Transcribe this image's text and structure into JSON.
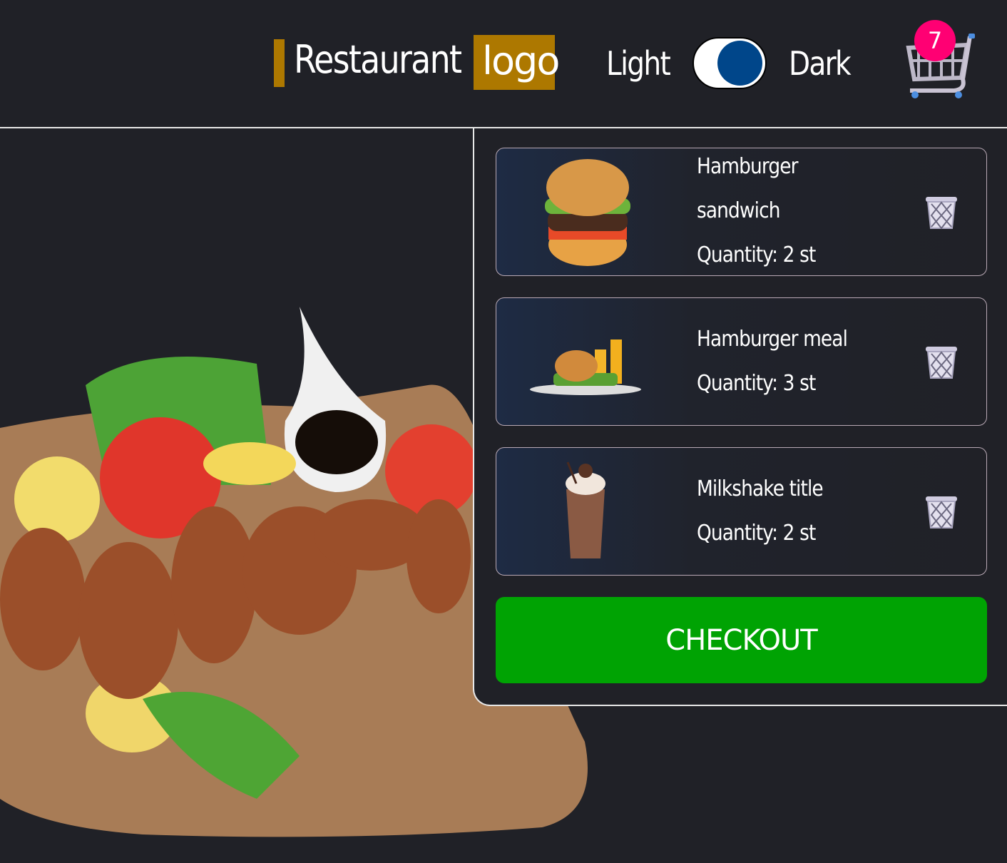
{
  "header": {
    "logo_word": "Restaurant",
    "logo_highlight": "logo",
    "theme_light_label": "Light",
    "theme_dark_label": "Dark",
    "theme_mode": "dark",
    "cart_count": "7",
    "cart_icon": "shopping-cart-icon"
  },
  "cart": {
    "items": [
      {
        "lines": [
          "Hamburger",
          "sandwich"
        ],
        "quantity_label": "Quantity:  2  st",
        "image": "hamburger"
      },
      {
        "lines": [
          "Hamburger  meal"
        ],
        "quantity_label": "Quantity:  3  st",
        "image": "hamburger-meal"
      },
      {
        "lines": [
          "Milkshake  title"
        ],
        "quantity_label": "Quantity:  2  st",
        "image": "milkshake"
      }
    ],
    "checkout_label": "CHECKOUT"
  },
  "colors": {
    "background": "#202127",
    "accent": "#ad7800",
    "badge": "#ff0073",
    "checkout": "#00a303",
    "toggle_knob": "#00468a"
  }
}
